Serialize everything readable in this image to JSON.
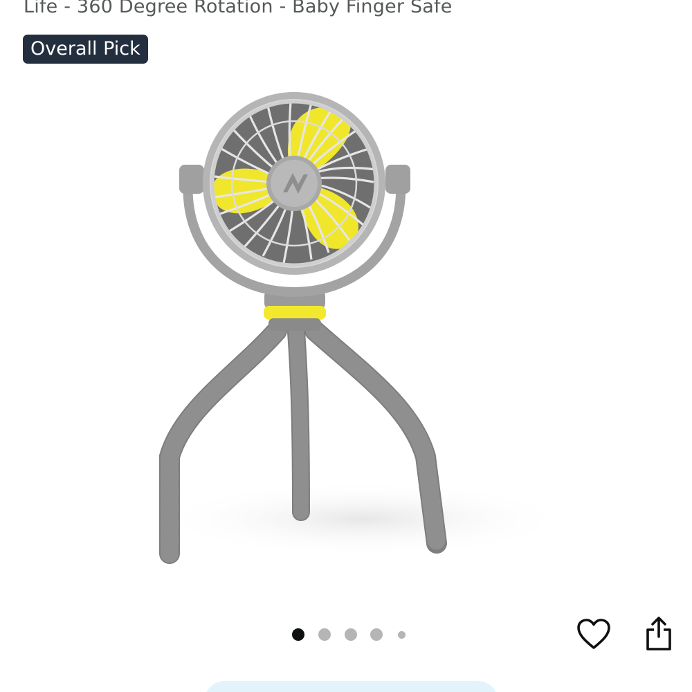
{
  "product": {
    "title": "Life - 360 Degree Rotation - Baby Finger Safe",
    "badge": "Overall Pick"
  },
  "image": {
    "icon": "stroller-fan-image",
    "colors": {
      "body": "#8c8c8c",
      "blade": "#f0e62c",
      "accent": "#f2e92f"
    }
  },
  "carousel": {
    "count": 5,
    "active_index": 0
  },
  "actions": {
    "wishlist_icon": "heart-icon",
    "share_icon": "share-icon"
  },
  "colors": {
    "badge_bg": "#232f3e",
    "title_text": "#565959",
    "dot_active": "#0f1111",
    "dot_inactive": "#b5b5b5",
    "pill_bg": "#e3f3fb"
  }
}
